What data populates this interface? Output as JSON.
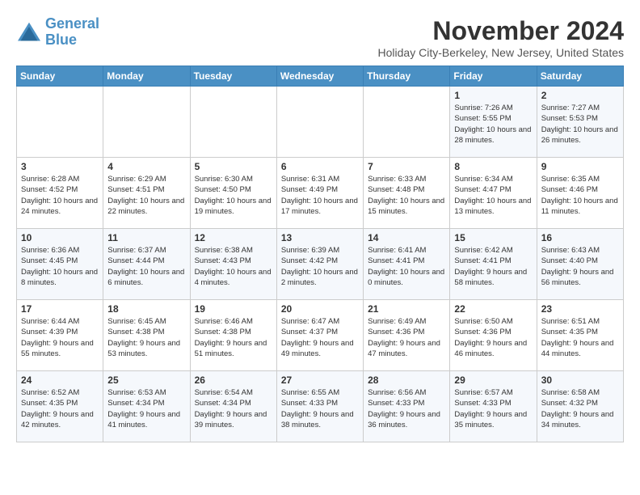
{
  "logo": {
    "line1": "General",
    "line2": "Blue"
  },
  "title": "November 2024",
  "subtitle": "Holiday City-Berkeley, New Jersey, United States",
  "weekdays": [
    "Sunday",
    "Monday",
    "Tuesday",
    "Wednesday",
    "Thursday",
    "Friday",
    "Saturday"
  ],
  "weeks": [
    [
      {
        "day": "",
        "info": ""
      },
      {
        "day": "",
        "info": ""
      },
      {
        "day": "",
        "info": ""
      },
      {
        "day": "",
        "info": ""
      },
      {
        "day": "",
        "info": ""
      },
      {
        "day": "1",
        "info": "Sunrise: 7:26 AM\nSunset: 5:55 PM\nDaylight: 10 hours and 28 minutes."
      },
      {
        "day": "2",
        "info": "Sunrise: 7:27 AM\nSunset: 5:53 PM\nDaylight: 10 hours and 26 minutes."
      }
    ],
    [
      {
        "day": "3",
        "info": "Sunrise: 6:28 AM\nSunset: 4:52 PM\nDaylight: 10 hours and 24 minutes."
      },
      {
        "day": "4",
        "info": "Sunrise: 6:29 AM\nSunset: 4:51 PM\nDaylight: 10 hours and 22 minutes."
      },
      {
        "day": "5",
        "info": "Sunrise: 6:30 AM\nSunset: 4:50 PM\nDaylight: 10 hours and 19 minutes."
      },
      {
        "day": "6",
        "info": "Sunrise: 6:31 AM\nSunset: 4:49 PM\nDaylight: 10 hours and 17 minutes."
      },
      {
        "day": "7",
        "info": "Sunrise: 6:33 AM\nSunset: 4:48 PM\nDaylight: 10 hours and 15 minutes."
      },
      {
        "day": "8",
        "info": "Sunrise: 6:34 AM\nSunset: 4:47 PM\nDaylight: 10 hours and 13 minutes."
      },
      {
        "day": "9",
        "info": "Sunrise: 6:35 AM\nSunset: 4:46 PM\nDaylight: 10 hours and 11 minutes."
      }
    ],
    [
      {
        "day": "10",
        "info": "Sunrise: 6:36 AM\nSunset: 4:45 PM\nDaylight: 10 hours and 8 minutes."
      },
      {
        "day": "11",
        "info": "Sunrise: 6:37 AM\nSunset: 4:44 PM\nDaylight: 10 hours and 6 minutes."
      },
      {
        "day": "12",
        "info": "Sunrise: 6:38 AM\nSunset: 4:43 PM\nDaylight: 10 hours and 4 minutes."
      },
      {
        "day": "13",
        "info": "Sunrise: 6:39 AM\nSunset: 4:42 PM\nDaylight: 10 hours and 2 minutes."
      },
      {
        "day": "14",
        "info": "Sunrise: 6:41 AM\nSunset: 4:41 PM\nDaylight: 10 hours and 0 minutes."
      },
      {
        "day": "15",
        "info": "Sunrise: 6:42 AM\nSunset: 4:41 PM\nDaylight: 9 hours and 58 minutes."
      },
      {
        "day": "16",
        "info": "Sunrise: 6:43 AM\nSunset: 4:40 PM\nDaylight: 9 hours and 56 minutes."
      }
    ],
    [
      {
        "day": "17",
        "info": "Sunrise: 6:44 AM\nSunset: 4:39 PM\nDaylight: 9 hours and 55 minutes."
      },
      {
        "day": "18",
        "info": "Sunrise: 6:45 AM\nSunset: 4:38 PM\nDaylight: 9 hours and 53 minutes."
      },
      {
        "day": "19",
        "info": "Sunrise: 6:46 AM\nSunset: 4:38 PM\nDaylight: 9 hours and 51 minutes."
      },
      {
        "day": "20",
        "info": "Sunrise: 6:47 AM\nSunset: 4:37 PM\nDaylight: 9 hours and 49 minutes."
      },
      {
        "day": "21",
        "info": "Sunrise: 6:49 AM\nSunset: 4:36 PM\nDaylight: 9 hours and 47 minutes."
      },
      {
        "day": "22",
        "info": "Sunrise: 6:50 AM\nSunset: 4:36 PM\nDaylight: 9 hours and 46 minutes."
      },
      {
        "day": "23",
        "info": "Sunrise: 6:51 AM\nSunset: 4:35 PM\nDaylight: 9 hours and 44 minutes."
      }
    ],
    [
      {
        "day": "24",
        "info": "Sunrise: 6:52 AM\nSunset: 4:35 PM\nDaylight: 9 hours and 42 minutes."
      },
      {
        "day": "25",
        "info": "Sunrise: 6:53 AM\nSunset: 4:34 PM\nDaylight: 9 hours and 41 minutes."
      },
      {
        "day": "26",
        "info": "Sunrise: 6:54 AM\nSunset: 4:34 PM\nDaylight: 9 hours and 39 minutes."
      },
      {
        "day": "27",
        "info": "Sunrise: 6:55 AM\nSunset: 4:33 PM\nDaylight: 9 hours and 38 minutes."
      },
      {
        "day": "28",
        "info": "Sunrise: 6:56 AM\nSunset: 4:33 PM\nDaylight: 9 hours and 36 minutes."
      },
      {
        "day": "29",
        "info": "Sunrise: 6:57 AM\nSunset: 4:33 PM\nDaylight: 9 hours and 35 minutes."
      },
      {
        "day": "30",
        "info": "Sunrise: 6:58 AM\nSunset: 4:32 PM\nDaylight: 9 hours and 34 minutes."
      }
    ]
  ]
}
